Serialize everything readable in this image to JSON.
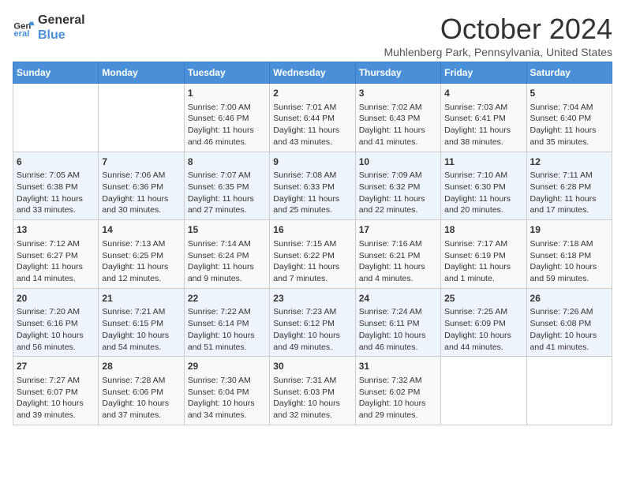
{
  "logo": {
    "line1": "General",
    "line2": "Blue"
  },
  "title": "October 2024",
  "subtitle": "Muhlenberg Park, Pennsylvania, United States",
  "days_of_week": [
    "Sunday",
    "Monday",
    "Tuesday",
    "Wednesday",
    "Thursday",
    "Friday",
    "Saturday"
  ],
  "weeks": [
    [
      {
        "day": "",
        "sunrise": "",
        "sunset": "",
        "daylight": ""
      },
      {
        "day": "",
        "sunrise": "",
        "sunset": "",
        "daylight": ""
      },
      {
        "day": "1",
        "sunrise": "Sunrise: 7:00 AM",
        "sunset": "Sunset: 6:46 PM",
        "daylight": "Daylight: 11 hours and 46 minutes."
      },
      {
        "day": "2",
        "sunrise": "Sunrise: 7:01 AM",
        "sunset": "Sunset: 6:44 PM",
        "daylight": "Daylight: 11 hours and 43 minutes."
      },
      {
        "day": "3",
        "sunrise": "Sunrise: 7:02 AM",
        "sunset": "Sunset: 6:43 PM",
        "daylight": "Daylight: 11 hours and 41 minutes."
      },
      {
        "day": "4",
        "sunrise": "Sunrise: 7:03 AM",
        "sunset": "Sunset: 6:41 PM",
        "daylight": "Daylight: 11 hours and 38 minutes."
      },
      {
        "day": "5",
        "sunrise": "Sunrise: 7:04 AM",
        "sunset": "Sunset: 6:40 PM",
        "daylight": "Daylight: 11 hours and 35 minutes."
      }
    ],
    [
      {
        "day": "6",
        "sunrise": "Sunrise: 7:05 AM",
        "sunset": "Sunset: 6:38 PM",
        "daylight": "Daylight: 11 hours and 33 minutes."
      },
      {
        "day": "7",
        "sunrise": "Sunrise: 7:06 AM",
        "sunset": "Sunset: 6:36 PM",
        "daylight": "Daylight: 11 hours and 30 minutes."
      },
      {
        "day": "8",
        "sunrise": "Sunrise: 7:07 AM",
        "sunset": "Sunset: 6:35 PM",
        "daylight": "Daylight: 11 hours and 27 minutes."
      },
      {
        "day": "9",
        "sunrise": "Sunrise: 7:08 AM",
        "sunset": "Sunset: 6:33 PM",
        "daylight": "Daylight: 11 hours and 25 minutes."
      },
      {
        "day": "10",
        "sunrise": "Sunrise: 7:09 AM",
        "sunset": "Sunset: 6:32 PM",
        "daylight": "Daylight: 11 hours and 22 minutes."
      },
      {
        "day": "11",
        "sunrise": "Sunrise: 7:10 AM",
        "sunset": "Sunset: 6:30 PM",
        "daylight": "Daylight: 11 hours and 20 minutes."
      },
      {
        "day": "12",
        "sunrise": "Sunrise: 7:11 AM",
        "sunset": "Sunset: 6:28 PM",
        "daylight": "Daylight: 11 hours and 17 minutes."
      }
    ],
    [
      {
        "day": "13",
        "sunrise": "Sunrise: 7:12 AM",
        "sunset": "Sunset: 6:27 PM",
        "daylight": "Daylight: 11 hours and 14 minutes."
      },
      {
        "day": "14",
        "sunrise": "Sunrise: 7:13 AM",
        "sunset": "Sunset: 6:25 PM",
        "daylight": "Daylight: 11 hours and 12 minutes."
      },
      {
        "day": "15",
        "sunrise": "Sunrise: 7:14 AM",
        "sunset": "Sunset: 6:24 PM",
        "daylight": "Daylight: 11 hours and 9 minutes."
      },
      {
        "day": "16",
        "sunrise": "Sunrise: 7:15 AM",
        "sunset": "Sunset: 6:22 PM",
        "daylight": "Daylight: 11 hours and 7 minutes."
      },
      {
        "day": "17",
        "sunrise": "Sunrise: 7:16 AM",
        "sunset": "Sunset: 6:21 PM",
        "daylight": "Daylight: 11 hours and 4 minutes."
      },
      {
        "day": "18",
        "sunrise": "Sunrise: 7:17 AM",
        "sunset": "Sunset: 6:19 PM",
        "daylight": "Daylight: 11 hours and 1 minute."
      },
      {
        "day": "19",
        "sunrise": "Sunrise: 7:18 AM",
        "sunset": "Sunset: 6:18 PM",
        "daylight": "Daylight: 10 hours and 59 minutes."
      }
    ],
    [
      {
        "day": "20",
        "sunrise": "Sunrise: 7:20 AM",
        "sunset": "Sunset: 6:16 PM",
        "daylight": "Daylight: 10 hours and 56 minutes."
      },
      {
        "day": "21",
        "sunrise": "Sunrise: 7:21 AM",
        "sunset": "Sunset: 6:15 PM",
        "daylight": "Daylight: 10 hours and 54 minutes."
      },
      {
        "day": "22",
        "sunrise": "Sunrise: 7:22 AM",
        "sunset": "Sunset: 6:14 PM",
        "daylight": "Daylight: 10 hours and 51 minutes."
      },
      {
        "day": "23",
        "sunrise": "Sunrise: 7:23 AM",
        "sunset": "Sunset: 6:12 PM",
        "daylight": "Daylight: 10 hours and 49 minutes."
      },
      {
        "day": "24",
        "sunrise": "Sunrise: 7:24 AM",
        "sunset": "Sunset: 6:11 PM",
        "daylight": "Daylight: 10 hours and 46 minutes."
      },
      {
        "day": "25",
        "sunrise": "Sunrise: 7:25 AM",
        "sunset": "Sunset: 6:09 PM",
        "daylight": "Daylight: 10 hours and 44 minutes."
      },
      {
        "day": "26",
        "sunrise": "Sunrise: 7:26 AM",
        "sunset": "Sunset: 6:08 PM",
        "daylight": "Daylight: 10 hours and 41 minutes."
      }
    ],
    [
      {
        "day": "27",
        "sunrise": "Sunrise: 7:27 AM",
        "sunset": "Sunset: 6:07 PM",
        "daylight": "Daylight: 10 hours and 39 minutes."
      },
      {
        "day": "28",
        "sunrise": "Sunrise: 7:28 AM",
        "sunset": "Sunset: 6:06 PM",
        "daylight": "Daylight: 10 hours and 37 minutes."
      },
      {
        "day": "29",
        "sunrise": "Sunrise: 7:30 AM",
        "sunset": "Sunset: 6:04 PM",
        "daylight": "Daylight: 10 hours and 34 minutes."
      },
      {
        "day": "30",
        "sunrise": "Sunrise: 7:31 AM",
        "sunset": "Sunset: 6:03 PM",
        "daylight": "Daylight: 10 hours and 32 minutes."
      },
      {
        "day": "31",
        "sunrise": "Sunrise: 7:32 AM",
        "sunset": "Sunset: 6:02 PM",
        "daylight": "Daylight: 10 hours and 29 minutes."
      },
      {
        "day": "",
        "sunrise": "",
        "sunset": "",
        "daylight": ""
      },
      {
        "day": "",
        "sunrise": "",
        "sunset": "",
        "daylight": ""
      }
    ]
  ]
}
